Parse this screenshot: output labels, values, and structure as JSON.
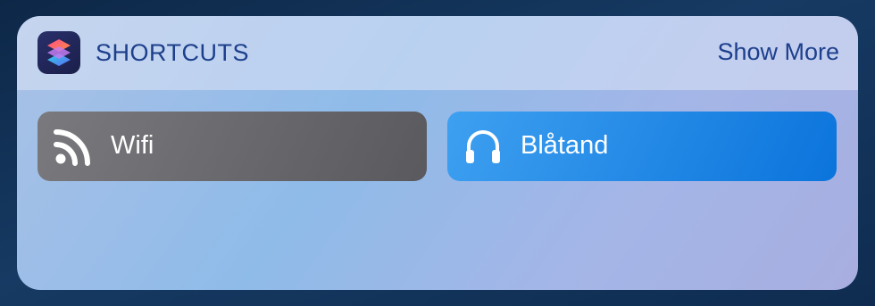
{
  "widget": {
    "title": "SHORTCUTS",
    "show_more_label": "Show More",
    "app_icon": "shortcuts-app-icon"
  },
  "shortcuts": [
    {
      "label": "Wifi",
      "icon": "rss-feed-icon",
      "color": "#6b6b6f"
    },
    {
      "label": "Blåtand",
      "icon": "headphones-icon",
      "color": "#1f8ae6"
    }
  ],
  "colors": {
    "accent": "#1d3f8c"
  }
}
